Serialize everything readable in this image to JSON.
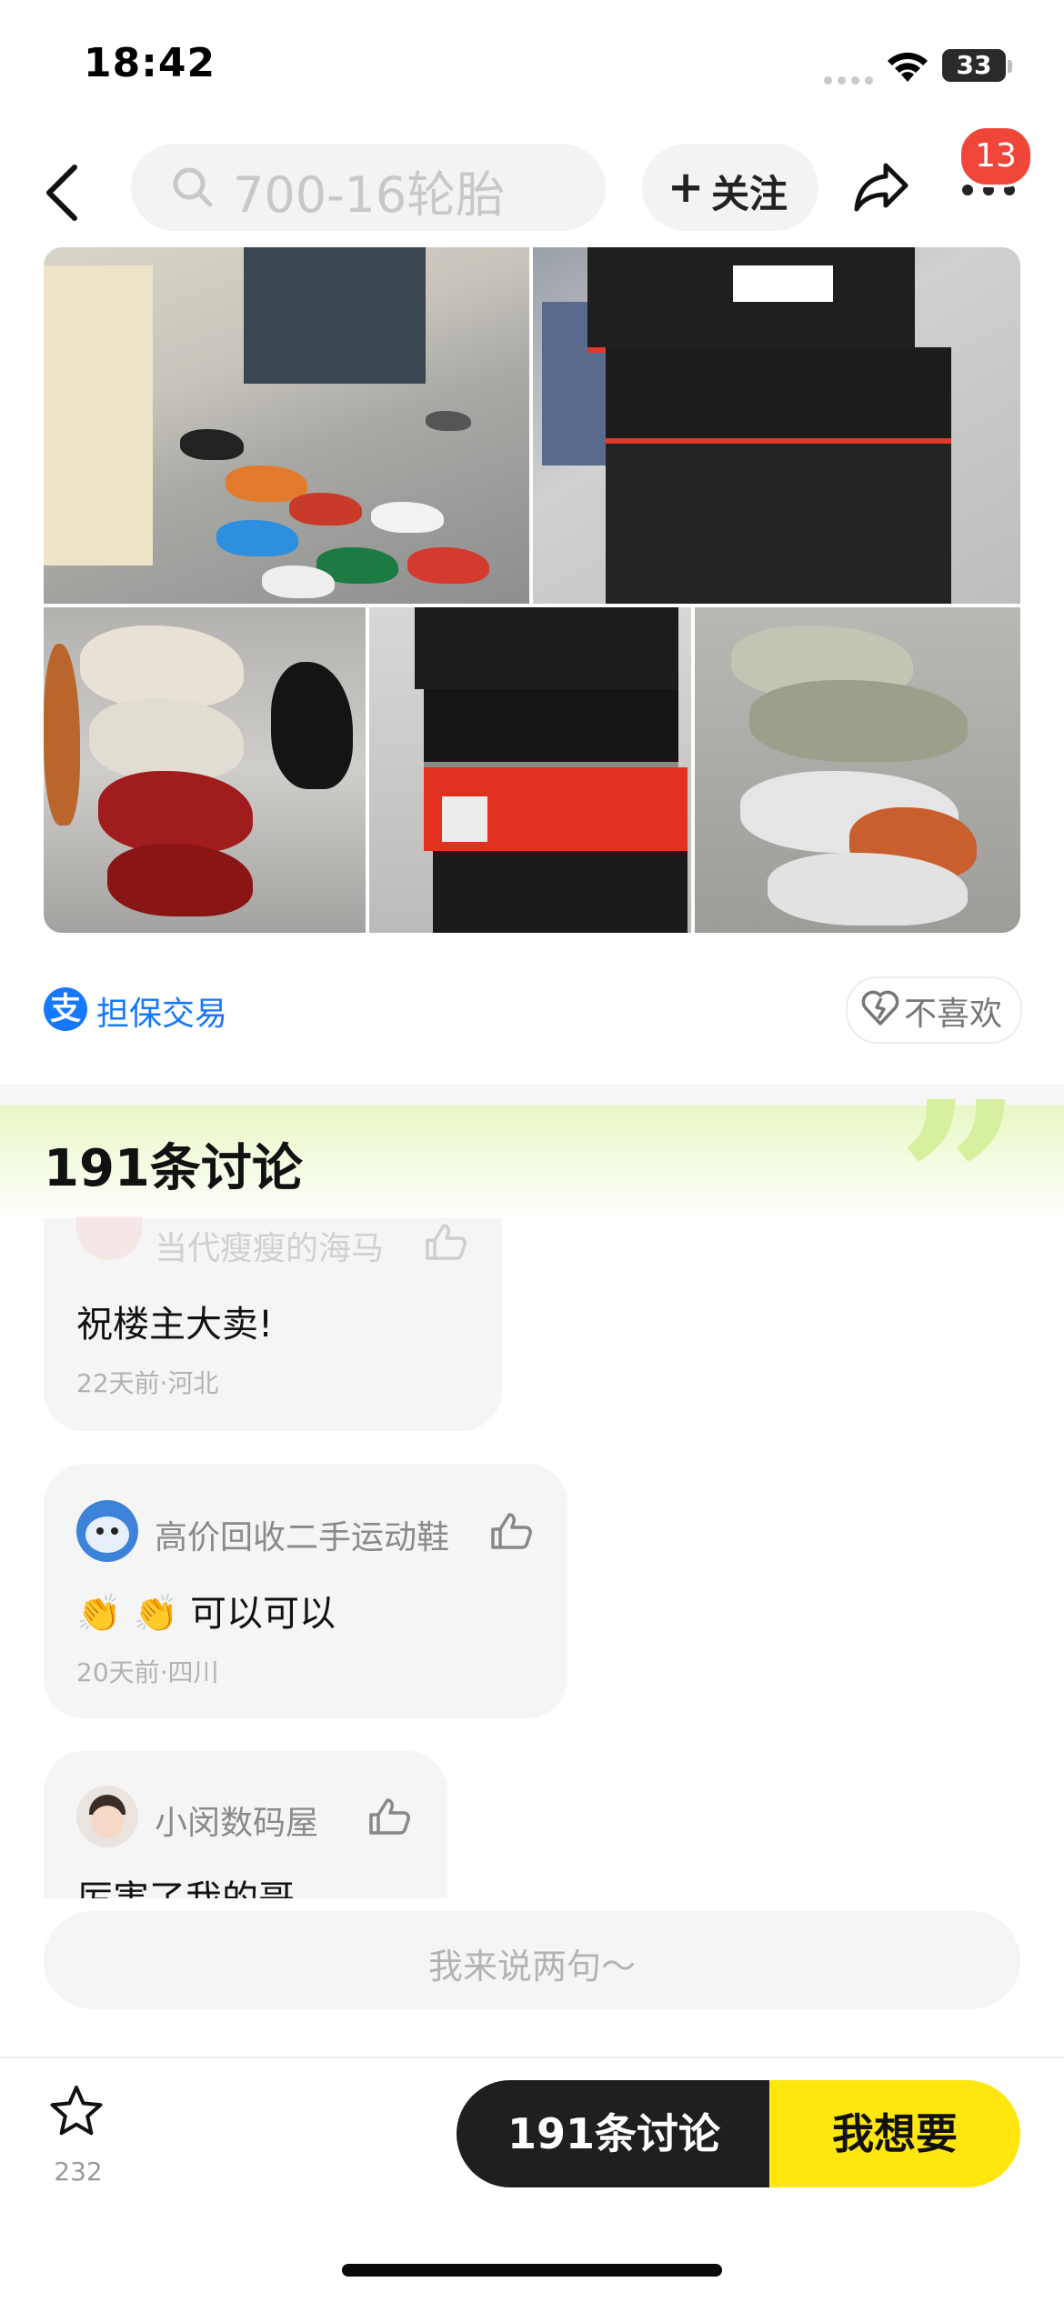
{
  "status_bar": {
    "time": "18:42",
    "battery": "33"
  },
  "nav": {
    "search_placeholder": "700-16轮胎",
    "follow_label": "关注",
    "follow_plus": "+",
    "notification_count": "13"
  },
  "guarantee": {
    "icon_char": "支",
    "label": "担保交易"
  },
  "dislike": {
    "label": "不喜欢"
  },
  "discussion": {
    "title": "191条讨论",
    "comments": [
      {
        "user": "当代瘦瘦的海马",
        "text": "祝楼主大卖!",
        "meta": "22天前·河北"
      },
      {
        "user": "高价回收二手运动鞋",
        "text": "👏 👏 可以可以",
        "meta": "20天前·四川"
      },
      {
        "user": "小闵数码屋",
        "text": "厉害了我的哥",
        "meta": ""
      }
    ]
  },
  "comment_input": {
    "placeholder": "我来说两句～"
  },
  "bottom_bar": {
    "favorite_count": "232",
    "discuss_label": "191条讨论",
    "want_label": "我想要"
  },
  "colors": {
    "accent_blue": "#1677ff",
    "want_yellow": "#ffe60f",
    "discuss_black": "#1f1f1f",
    "badge_red": "#f0463a"
  },
  "icons": [
    "back-icon",
    "search-icon",
    "plus-icon",
    "share-icon",
    "more-icon",
    "alipay-icon",
    "broken-heart-icon",
    "thumb-up-icon",
    "star-icon"
  ]
}
